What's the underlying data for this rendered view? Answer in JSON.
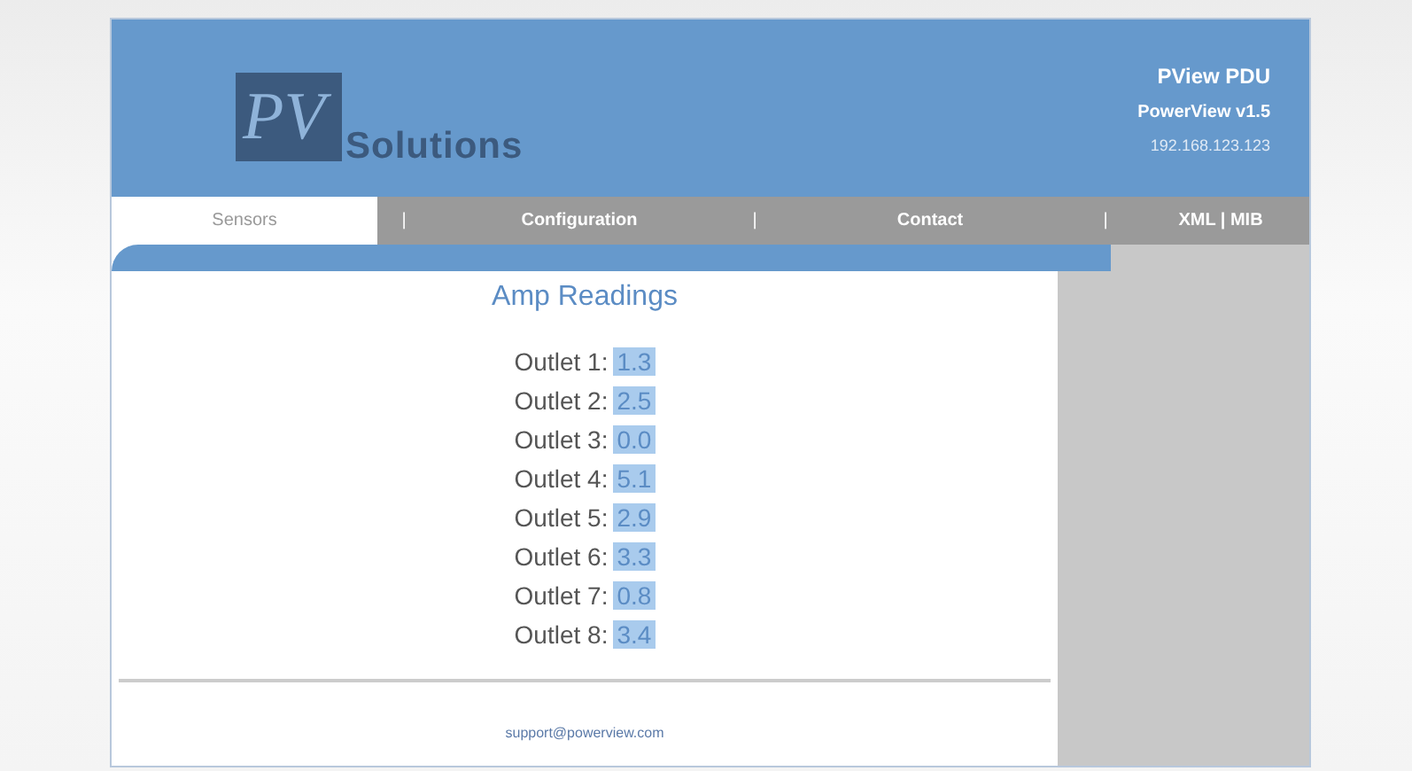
{
  "logo": {
    "mark": "PV",
    "name": "Solutions"
  },
  "header_info": [
    "PView PDU",
    "PowerView v1.5",
    "192.168.123.123"
  ],
  "nav": [
    {
      "kind": "tab",
      "label": "Sensors",
      "selected": true
    },
    {
      "kind": "separator",
      "label": "|"
    },
    {
      "kind": "tab",
      "label": "Configuration",
      "selected": false
    },
    {
      "kind": "separator",
      "label": "|"
    },
    {
      "kind": "tab",
      "label": "Contact",
      "selected": false
    },
    {
      "kind": "separator",
      "label": "|"
    },
    {
      "kind": "tab",
      "label": "XML | MIB",
      "selected": false
    }
  ],
  "title": "Amp Readings",
  "outlets": [
    {
      "label": "Outlet 1:",
      "value": "1.3"
    },
    {
      "label": "Outlet 2:",
      "value": "2.5"
    },
    {
      "label": "Outlet 3:",
      "value": "0.0"
    },
    {
      "label": "Outlet 4:",
      "value": "5.1"
    },
    {
      "label": "Outlet 5:",
      "value": "2.9"
    },
    {
      "label": "Outlet 6:",
      "value": "3.3"
    },
    {
      "label": "Outlet 7:",
      "value": "0.8"
    },
    {
      "label": "Outlet 8:",
      "value": "3.4"
    }
  ],
  "footer_link": "support@powerview.com"
}
